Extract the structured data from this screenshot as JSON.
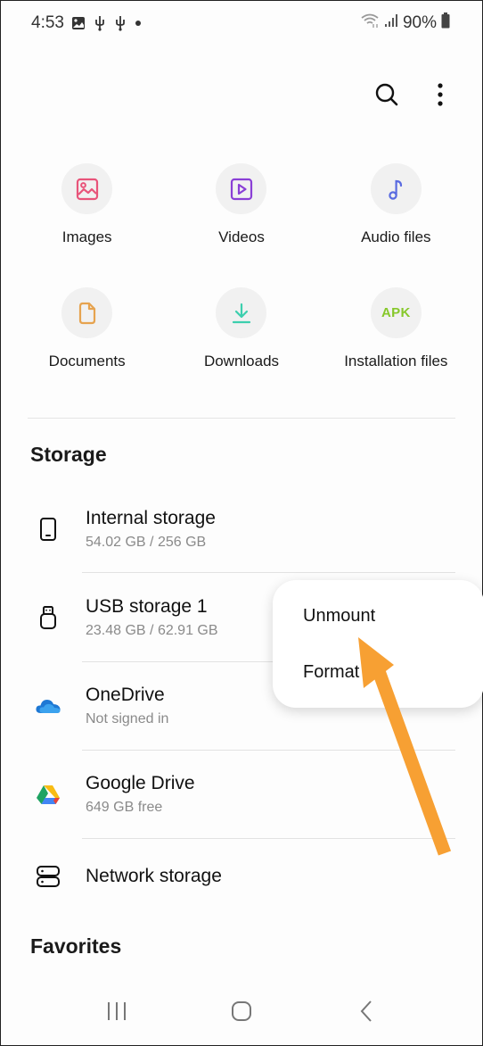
{
  "status_bar": {
    "time": "4:53",
    "battery": "90%",
    "left_icons": [
      "gallery-notification-icon",
      "usb-icon",
      "usb-icon",
      "dot-icon"
    ],
    "right_icons": [
      "wifi-icon",
      "signal-icon",
      "battery-icon"
    ]
  },
  "toolbar": {
    "search_icon": "search-icon",
    "more_icon": "more-options-icon"
  },
  "categories": [
    {
      "label": "Images",
      "icon": "image-icon",
      "color": "#e8547a"
    },
    {
      "label": "Videos",
      "icon": "video-icon",
      "color": "#8a3fd6"
    },
    {
      "label": "Audio files",
      "icon": "music-note-icon",
      "color": "#5a6be0"
    },
    {
      "label": "Documents",
      "icon": "document-icon",
      "color": "#e6a34f"
    },
    {
      "label": "Downloads",
      "icon": "download-icon",
      "color": "#3ccfae"
    },
    {
      "label": "Installation files",
      "icon": "apk-icon",
      "icon_text": "APK",
      "color": "#86c82a"
    }
  ],
  "storage": {
    "title": "Storage",
    "items": [
      {
        "name": "Internal storage",
        "sub": "54.02 GB / 256 GB",
        "icon": "phone-icon"
      },
      {
        "name": "USB storage 1",
        "sub": "23.48 GB / 62.91 GB",
        "icon": "usb-drive-icon"
      },
      {
        "name": "OneDrive",
        "sub": "Not signed in",
        "icon": "onedrive-icon"
      },
      {
        "name": "Google Drive",
        "sub": "649 GB free",
        "icon": "google-drive-icon"
      },
      {
        "name": "Network storage",
        "icon": "network-storage-icon"
      }
    ]
  },
  "favorites": {
    "title": "Favorites"
  },
  "context_menu": {
    "items": [
      "Unmount",
      "Format"
    ]
  },
  "annotation": {
    "arrow_color": "#f7a033"
  },
  "navbar": {
    "recents": "recents-icon",
    "home": "home-icon",
    "back": "back-icon"
  }
}
